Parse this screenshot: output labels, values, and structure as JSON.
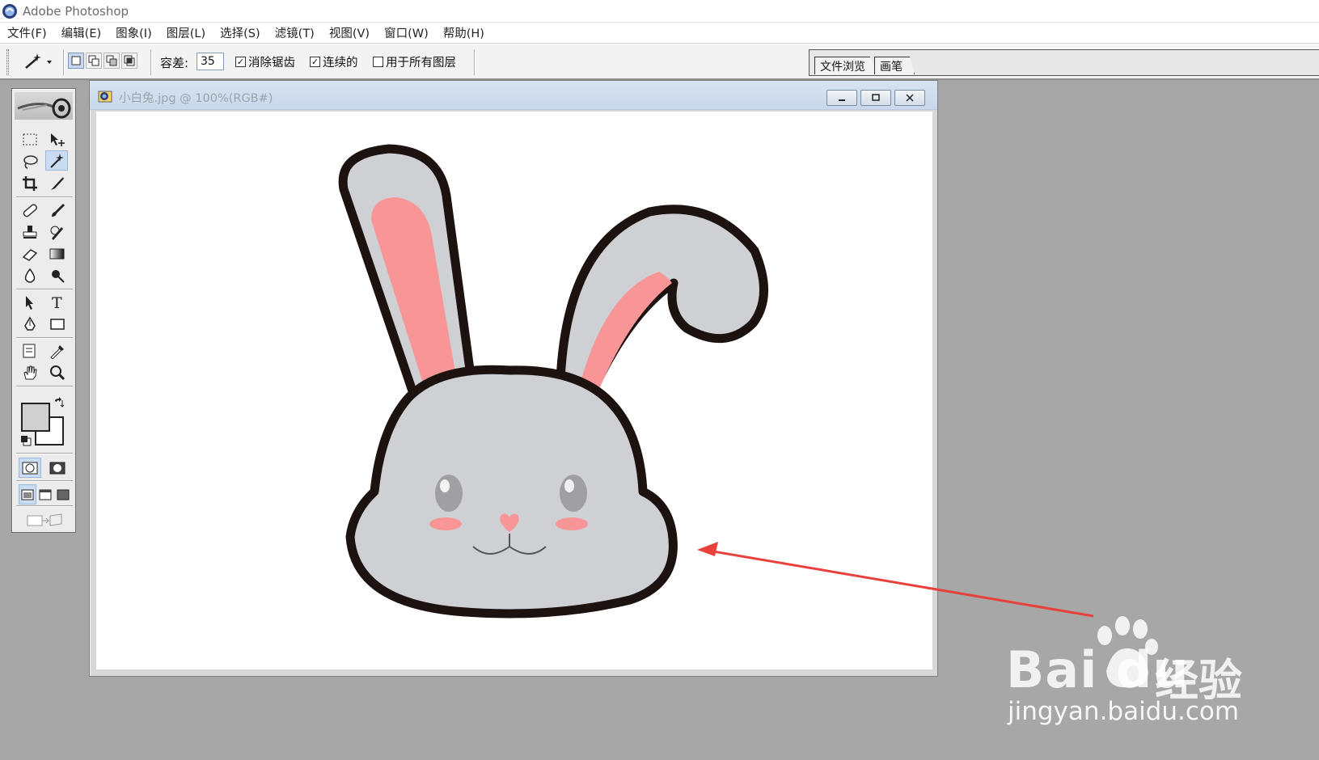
{
  "window": {
    "title": "Adobe Photoshop"
  },
  "menu": [
    "文件(F)",
    "编辑(E)",
    "图象(I)",
    "图层(L)",
    "选择(S)",
    "滤镜(T)",
    "视图(V)",
    "窗口(W)",
    "帮助(H)"
  ],
  "options_bar": {
    "tool_icon": "magic-wand-icon",
    "selection_modes": [
      "new-selection",
      "add-to-selection",
      "subtract-from-selection",
      "intersect-selection"
    ],
    "tolerance_label": "容差:",
    "tolerance_value": "35",
    "anti_alias": {
      "label": "消除锯齿",
      "checked": true
    },
    "contiguous": {
      "label": "连续的",
      "checked": true
    },
    "use_all_layers": {
      "label": "用于所有图层",
      "checked": false
    },
    "palette_well_tabs": [
      "文件浏览",
      "画笔"
    ]
  },
  "toolbox": {
    "active_tool": "magic-wand",
    "foreground_color": "#d0d0d0",
    "background_color": "#ffffff"
  },
  "document": {
    "title": "小白兔.jpg @ 100%(RGB#)"
  },
  "colors": {
    "bunny_fill": "#cfd0d4",
    "bunny_outline": "#1c1210",
    "ear_inner": "#f89697",
    "arrow": "#e8403a"
  },
  "watermark": {
    "brand": "Bai du",
    "product": "经验",
    "url": "jingyan.baidu.com"
  }
}
